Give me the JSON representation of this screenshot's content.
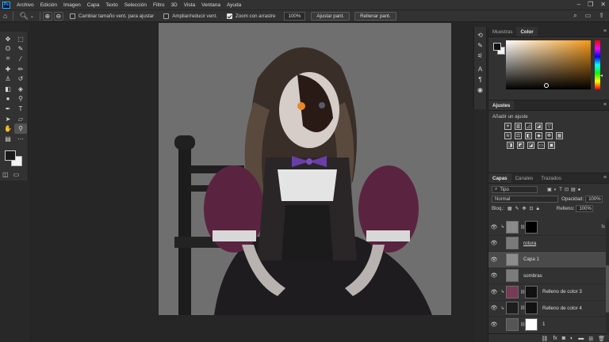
{
  "menu": [
    "Archivo",
    "Edición",
    "Imagen",
    "Capa",
    "Texto",
    "Selección",
    "Filtro",
    "3D",
    "Vista",
    "Ventana",
    "Ayuda"
  ],
  "app_logo": "Ps",
  "options": {
    "chk_resize": "Cambiar tamaño vent. para ajustar",
    "chk_resize_on": false,
    "chk_zoom_all": "Ampliar/reducir vent.",
    "chk_zoom_all_on": false,
    "chk_scrubby": "Zoom con arrastre",
    "chk_scrubby_on": true,
    "zoom_value": "100%",
    "fit_button": "Ajustar pant.",
    "fill_button": "Rellenar pant."
  },
  "color_panel": {
    "tabs": [
      "Muestras",
      "Color"
    ],
    "active_tab": "Color",
    "hue_color": "#f49a1a"
  },
  "adjust_panel": {
    "tab": "Ajustes",
    "title": "Añadir un ajuste"
  },
  "layers_panel": {
    "tabs": [
      "Capas",
      "Canales",
      "Trazados"
    ],
    "active_tab": "Capas",
    "filter": "Tipo",
    "blend_mode": "Normal",
    "opacity_label": "Opacidad:",
    "opacity_value": "100%",
    "lock_label": "Bloq.:",
    "fill_label": "Relleno:",
    "fill_value": "100%",
    "layers": [
      {
        "name": "",
        "thumb": "#8a8a8a",
        "mask": "#000000",
        "clipped": true,
        "fx": true
      },
      {
        "name": "rotura",
        "thumb": "#7a7a7a",
        "underline": true
      },
      {
        "name": "Capa 1",
        "thumb": "#8c8c8c",
        "selected": true
      },
      {
        "name": "sombras",
        "thumb": "#7c7c7c"
      },
      {
        "name": "Relleno de color 3",
        "thumb": "#7a3a55",
        "mask": "#111111",
        "clipped": true
      },
      {
        "name": "Relleno de color 4",
        "thumb": "#1d1d1d",
        "mask": "#111111",
        "clipped": true
      },
      {
        "name": "1",
        "thumb": "#555555",
        "mask": "#ffffff"
      }
    ]
  }
}
